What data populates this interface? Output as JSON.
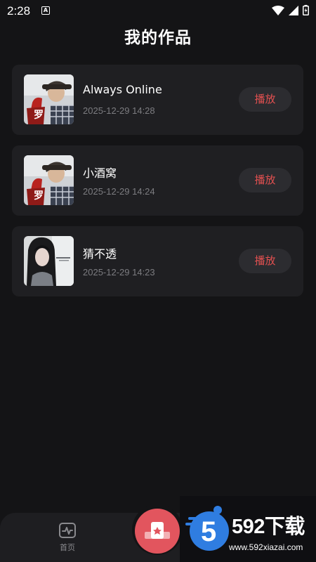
{
  "status": {
    "time": "2:28",
    "a_badge": "A"
  },
  "page": {
    "title": "我的作品"
  },
  "works": [
    {
      "title": "Always Online",
      "date": "2025-12-29 14:28",
      "play_label": "播放",
      "cover": "male-singer-cover"
    },
    {
      "title": "小酒窝",
      "date": "2025-12-29 14:24",
      "play_label": "播放",
      "cover": "male-singer-cover"
    },
    {
      "title": "猜不透",
      "date": "2025-12-29 14:23",
      "play_label": "播放",
      "cover": "female-singer-cover"
    }
  ],
  "bottom_nav": {
    "home_label": "首页",
    "center_icon": "record-icon"
  },
  "watermark": {
    "logo_text": "5",
    "brand": "592下载",
    "url": "www.592xiazai.com"
  },
  "colors": {
    "background": "#141416",
    "card": "#1f1f22",
    "accent_red": "#e25050",
    "center_button": "#e2555e"
  }
}
